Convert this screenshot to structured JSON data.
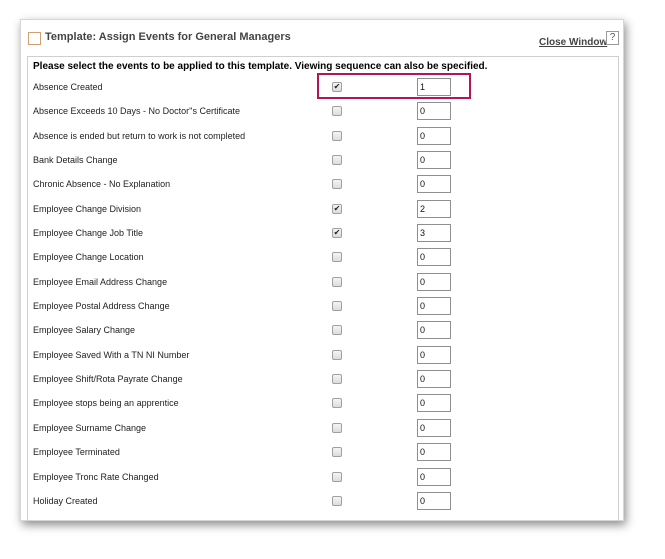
{
  "header": {
    "title": "Template: Assign Events for General Managers",
    "close_label": "Close Window",
    "help_label": "?"
  },
  "panel": {
    "instructions": "Please select the events to be applied to this template. Viewing sequence can also be specified."
  },
  "events": [
    {
      "label": "Absence Created",
      "checked": true,
      "sequence": "1"
    },
    {
      "label": "Absence Exceeds 10 Days - No Doctor''s Certificate",
      "checked": false,
      "sequence": "0"
    },
    {
      "label": "Absence is ended but return to work is not completed",
      "checked": false,
      "sequence": "0"
    },
    {
      "label": "Bank Details Change",
      "checked": false,
      "sequence": "0"
    },
    {
      "label": "Chronic Absence - No Explanation",
      "checked": false,
      "sequence": "0"
    },
    {
      "label": "Employee Change Division",
      "checked": true,
      "sequence": "2"
    },
    {
      "label": "Employee Change Job Title",
      "checked": true,
      "sequence": "3"
    },
    {
      "label": "Employee Change Location",
      "checked": false,
      "sequence": "0"
    },
    {
      "label": "Employee Email Address Change",
      "checked": false,
      "sequence": "0"
    },
    {
      "label": "Employee Postal Address Change",
      "checked": false,
      "sequence": "0"
    },
    {
      "label": "Employee Salary Change",
      "checked": false,
      "sequence": "0"
    },
    {
      "label": "Employee Saved With a TN NI Number",
      "checked": false,
      "sequence": "0"
    },
    {
      "label": "Employee Shift/Rota Payrate Change",
      "checked": false,
      "sequence": "0"
    },
    {
      "label": "Employee stops being an apprentice",
      "checked": false,
      "sequence": "0"
    },
    {
      "label": "Employee Surname Change",
      "checked": false,
      "sequence": "0"
    },
    {
      "label": "Employee Terminated",
      "checked": false,
      "sequence": "0"
    },
    {
      "label": "Employee Tronc Rate Changed",
      "checked": false,
      "sequence": "0"
    },
    {
      "label": "Holiday Created",
      "checked": false,
      "sequence": "0"
    }
  ],
  "colors": {
    "highlight": "#b5145a",
    "title_checkbox_border": "#d0a070"
  },
  "icons": {
    "checked": "check-mark",
    "help": "help-icon"
  }
}
